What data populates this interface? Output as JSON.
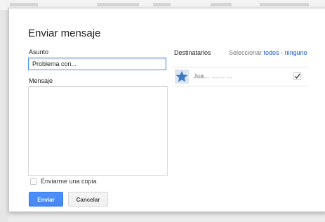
{
  "dialog": {
    "title": "Enviar mensaje",
    "subject": {
      "label": "Asunto",
      "value": "Problema con..."
    },
    "message": {
      "label": "Mensaje",
      "value": ""
    },
    "copy_to_self": {
      "label": "Enviarme una copia",
      "checked": false
    },
    "buttons": {
      "send": "Enviar",
      "cancel": "Cancelar"
    },
    "recipients": {
      "title": "Destinatarios",
      "select_prefix": "Seleccionar",
      "select_all": "todos",
      "separator": "-",
      "select_none": "ninguno",
      "items": [
        {
          "name": "Jua… ....... …",
          "checked": true
        }
      ]
    }
  },
  "colors": {
    "primary": "#4d90fe",
    "link": "#1155cc",
    "avatar_star": "#3f79c9"
  }
}
